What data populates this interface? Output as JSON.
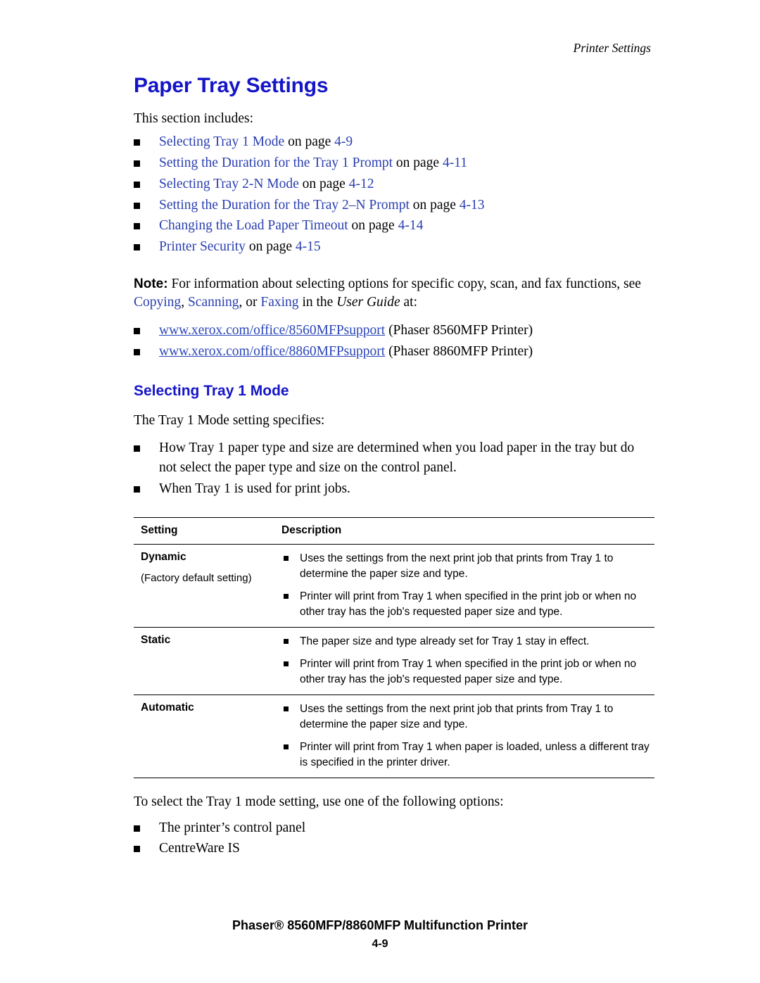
{
  "header": {
    "running_head": "Printer Settings"
  },
  "main": {
    "title": "Paper Tray Settings",
    "intro": "This section includes:",
    "toc": [
      {
        "link": "Selecting Tray 1 Mode",
        "tail": " on page ",
        "page": "4-9"
      },
      {
        "link": "Setting the Duration for the Tray 1 Prompt",
        "tail": " on page ",
        "page": "4-11"
      },
      {
        "link": "Selecting Tray 2-N Mode",
        "tail": " on page ",
        "page": "4-12"
      },
      {
        "link": "Setting the Duration for the Tray 2–N Prompt",
        "tail": " on page ",
        "page": "4-13"
      },
      {
        "link": "Changing the Load Paper Timeout",
        "tail": " on page ",
        "page": "4-14"
      },
      {
        "link": "Printer Security",
        "tail": " on page ",
        "page": "4-15"
      }
    ],
    "note": {
      "label": "Note:",
      "text_part1": " For information about selecting options for specific copy, scan, and fax functions, see ",
      "link1": "Copying",
      "sep1": ", ",
      "link2": "Scanning",
      "sep2": ", or ",
      "link3": "Faxing",
      "text_part2": " in the ",
      "italic": "User Guide",
      "text_part3": " at:"
    },
    "support_links": [
      {
        "url": "www.xerox.com/office/8560MFPsupport",
        "label": " (Phaser 8560MFP Printer)"
      },
      {
        "url": "www.xerox.com/office/8860MFPsupport",
        "label": " (Phaser 8860MFP Printer)"
      }
    ],
    "section": {
      "heading": "Selecting Tray 1 Mode",
      "lead": "The Tray 1 Mode setting specifies:",
      "bullets": [
        "How Tray 1 paper type and size are determined when you load paper in the tray but do not select the paper type and size on the control panel.",
        "When Tray 1 is used for print jobs."
      ]
    },
    "table": {
      "headers": [
        "Setting",
        "Description"
      ],
      "rows": [
        {
          "title": "Dynamic",
          "subtitle": "(Factory default setting)",
          "items": [
            "Uses the settings from the next print job that prints from Tray 1 to determine the paper size and type.",
            "Printer will print from Tray 1 when specified in the print job or when no other tray has the job's requested paper size and type."
          ]
        },
        {
          "title": "Static",
          "subtitle": "",
          "items": [
            "The paper size and type already set for Tray 1 stay in effect.",
            "Printer will print from Tray 1 when specified in the print job or when no other tray has the job's requested paper size and type."
          ]
        },
        {
          "title": "Automatic",
          "subtitle": "",
          "items": [
            "Uses the settings from the next print job that prints from Tray 1 to determine the paper size and type.",
            "Printer will print from Tray 1 when paper is loaded, unless a different tray is specified in the printer driver."
          ]
        }
      ]
    },
    "closing": {
      "lead": "To select the Tray 1 mode setting, use one of the following options:",
      "bullets": [
        "The printer’s control panel",
        "CentreWare IS"
      ]
    }
  },
  "footer": {
    "line1": "Phaser® 8560MFP/8860MFP Multifunction Printer",
    "line2": "4-9"
  }
}
